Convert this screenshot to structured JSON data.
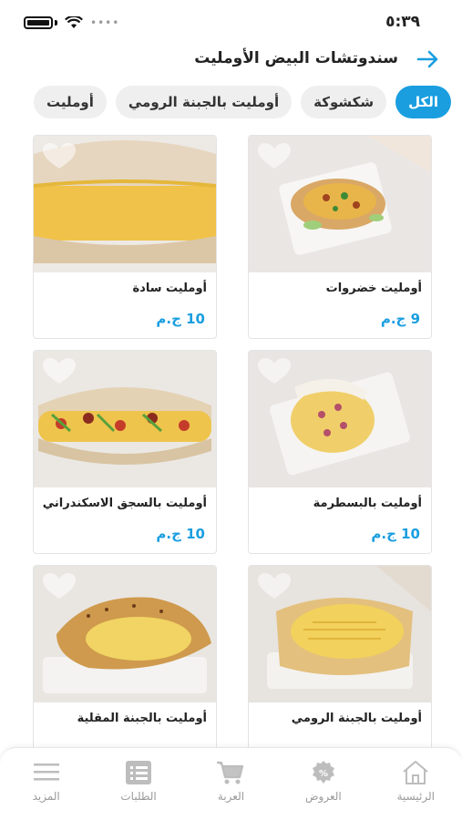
{
  "status": {
    "time": "٥:٣٩"
  },
  "header": {
    "title": "سندوتشات البيض الأومليت",
    "back_icon": "arrow-right-icon"
  },
  "colors": {
    "accent": "#1a9ee0",
    "chip_bg": "#efefef",
    "nav_icon": "#bdbdbd"
  },
  "categories": [
    {
      "label": "الكل",
      "active": true
    },
    {
      "label": "شكشوكة",
      "active": false
    },
    {
      "label": "أومليت بالجبنة الرومي",
      "active": false
    },
    {
      "label": "أومليت",
      "active": false
    }
  ],
  "products": [
    {
      "name": "أومليت خضروات",
      "price": "9 ج.م",
      "favorite_icon": "heart-icon"
    },
    {
      "name": "أومليت سادة",
      "price": "10 ج.م",
      "favorite_icon": "heart-icon"
    },
    {
      "name": "أومليت بالبسطرمة",
      "price": "10 ج.م",
      "favorite_icon": "heart-icon"
    },
    {
      "name": "أومليت بالسجق الاسكندراني",
      "price": "10 ج.م",
      "favorite_icon": "heart-icon"
    },
    {
      "name": "أومليت بالجبنة الرومي",
      "price": "",
      "favorite_icon": "heart-icon"
    },
    {
      "name": "أومليت بالجبنة المقلية",
      "price": "",
      "favorite_icon": "heart-icon"
    }
  ],
  "nav": [
    {
      "label": "الرئيسية",
      "icon": "home-icon"
    },
    {
      "label": "العروض",
      "icon": "discount-icon"
    },
    {
      "label": "العربة",
      "icon": "cart-icon"
    },
    {
      "label": "الطلبات",
      "icon": "orders-list-icon"
    },
    {
      "label": "المزيد",
      "icon": "menu-icon"
    }
  ]
}
